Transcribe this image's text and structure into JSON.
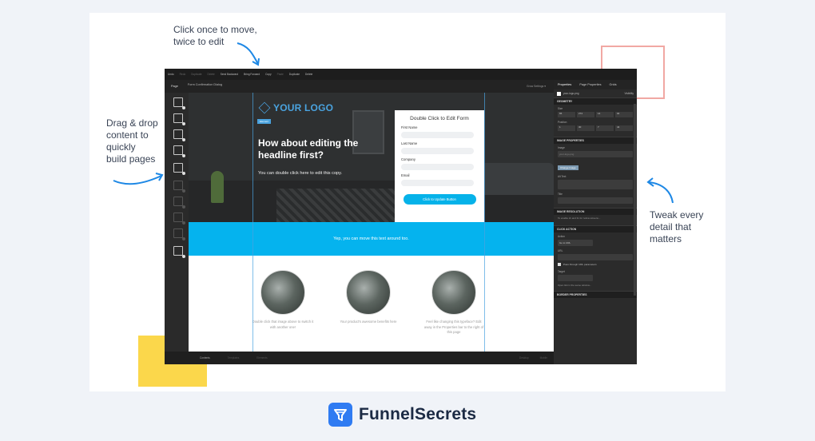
{
  "annotations": {
    "move_edit": [
      "Click once to move,",
      "twice to edit"
    ],
    "drag_drop": [
      "Drag & drop",
      "content to",
      "quickly",
      "build pages"
    ],
    "tweak": [
      "Tweak every",
      "detail that",
      "matters"
    ]
  },
  "colors": {
    "accent_blue": "#05b3ee",
    "pink_deco": "#f1a8a3",
    "yellow_deco": "#fbd74b",
    "brand_blue": "#2f7bf2"
  },
  "toolbar": {
    "items": [
      "Undo",
      "Redo",
      "Duplicate",
      "Delete",
      "Send Backward",
      "Bring Forward",
      "Copy",
      "Paste",
      "Duplicate",
      "Delete"
    ]
  },
  "subbar": {
    "page_tab": "Page",
    "form_title": "Form Confirmation Dialog",
    "settings": "Grow Settings ▾"
  },
  "hero": {
    "logo_text": "YOUR LOGO",
    "badge": "Element",
    "headline": "How about editing the headline first?",
    "subcopy": "You can double click here to edit this copy."
  },
  "form": {
    "title": "Double Click to Edit Form",
    "fields": [
      "First Name",
      "Last Name",
      "Company",
      "Email"
    ],
    "button": "Click to Update Button"
  },
  "band": {
    "text": "Yep, you can move this text around too."
  },
  "features": [
    {
      "text": "Double click that image above to switch it with another one!"
    },
    {
      "text": "Your product's awesome benefits here"
    },
    {
      "text": "Feel like changing this typeface? Edit away in the Properties bar to the right of this page"
    }
  ],
  "bottombar": {
    "items": [
      "Contents",
      "Templates",
      "Elements"
    ],
    "right": [
      "Desktop",
      "Mobile"
    ]
  },
  "panel": {
    "tabs": [
      "Properties",
      "Page Properties",
      "Grids"
    ],
    "file": "your-logo.png",
    "file_state": "Visibility",
    "sections": {
      "geometry": "GEOMETRY",
      "image_properties": "IMAGE PROPERTIES",
      "image_resolution": "IMAGE RESOLUTION",
      "click_action": "CLICK ACTION",
      "border_properties": "BORDER PROPERTIES"
    },
    "labels": {
      "size": "Size",
      "position": "Position",
      "image": "Image",
      "alt_text": "Alt Text",
      "title": "Title",
      "action": "Action",
      "url": "URL",
      "target": "Target"
    },
    "geometry_values": [
      "65",
      "274",
      "14",
      "94"
    ],
    "position_values": [
      "1",
      "30",
      "7",
      "44"
    ],
    "image_placeholder": "your-logo.png",
    "change_image": "Change Image",
    "resolution_note": "To enable 2x and 3x for retina screens...",
    "action_value": "Go to URL",
    "pass_url": "Pass through URL parameters",
    "target_note": "Open link in the same window..."
  },
  "brand": {
    "name": "FunnelSecrets"
  }
}
